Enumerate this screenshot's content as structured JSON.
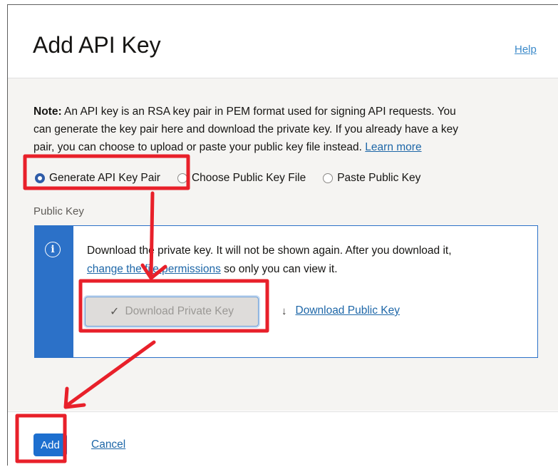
{
  "dialog": {
    "title": "Add API Key",
    "help_label": "Help"
  },
  "note": {
    "bold_prefix": "Note:",
    "line1_rest": " An API key is an RSA key pair in PEM format used for signing API requests. You",
    "line2": "can generate the key pair here and download the private key. If you already have a key",
    "line3": "pair, you can choose to upload or paste your public key file instead. ",
    "learn_more": "Learn more"
  },
  "key_options": [
    {
      "label": "Generate API Key Pair",
      "selected": true
    },
    {
      "label": "Choose Public Key File",
      "selected": false
    },
    {
      "label": "Paste Public Key",
      "selected": false
    }
  ],
  "public_key_section": {
    "label": "Public Key",
    "info_icon": "info-icon",
    "message_line1": "Download the private key. It will not be shown again. After you download it,",
    "permissions_link": "change the file permissions",
    "message_line2_rest": " so only you can view it.",
    "download_private_label": "Download Private Key",
    "download_public_label": "Download Public Key"
  },
  "footer": {
    "add_label": "Add",
    "cancel_label": "Cancel"
  },
  "colors": {
    "annotation": "#e8202a",
    "primary": "#1d6fcf",
    "link": "#1e67a8",
    "info_strip": "#2c71c8"
  }
}
